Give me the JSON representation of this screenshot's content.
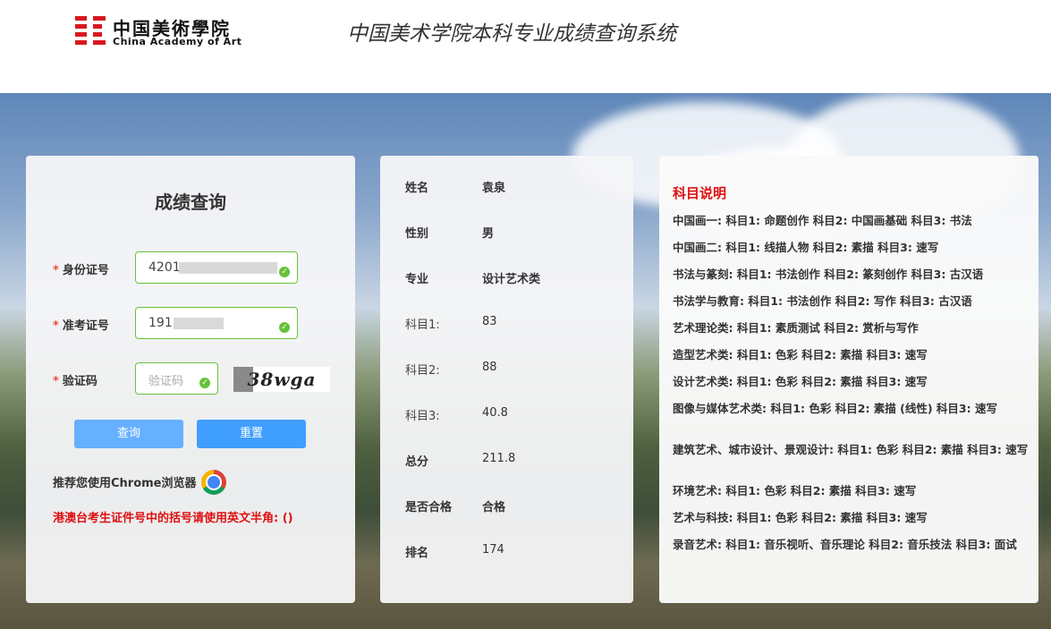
{
  "header": {
    "logo_cn": "中国美術學院",
    "logo_en": "China Academy of Art",
    "system_title": "中国美术学院本科专业成绩查询系统"
  },
  "query_form": {
    "title": "成绩查询",
    "required_mark": "*",
    "id_label": "身份证号",
    "id_value": "4201",
    "exam_label": "准考证号",
    "exam_value": "191",
    "captcha_label": "验证码",
    "captcha_placeholder": "验证码",
    "captcha_image_text": "38wga",
    "query_button": "查询",
    "reset_button": "重置",
    "browser_tip": "推荐您使用Chrome浏览器",
    "warning": "港澳台考生证件号中的括号请使用英文半角: ()"
  },
  "result": {
    "rows": [
      {
        "key": "姓名",
        "value": "袁泉"
      },
      {
        "key": "性别",
        "value": "男"
      },
      {
        "key": "专业",
        "value": "设计艺术类"
      },
      {
        "key": "科目1:",
        "value": "83"
      },
      {
        "key": "科目2:",
        "value": "88"
      },
      {
        "key": "科目3:",
        "value": "40.8"
      },
      {
        "key": "总分",
        "value": "211.8"
      },
      {
        "key": "是否合格",
        "value": "合格"
      },
      {
        "key": "排名",
        "value": "174"
      }
    ]
  },
  "subjects": {
    "title": "科目说明",
    "items": [
      "中国画一: 科目1: 命题创作 科目2: 中国画基础 科目3: 书法",
      "中国画二: 科目1: 线描人物 科目2: 素描 科目3: 速写",
      "书法与篆刻: 科目1: 书法创作 科目2: 篆刻创作 科目3: 古汉语",
      "书法学与教育: 科目1: 书法创作 科目2: 写作 科目3: 古汉语",
      "艺术理论类: 科目1: 素质测试 科目2: 赏析与写作",
      "造型艺术类: 科目1: 色彩 科目2: 素描 科目3: 速写",
      "设计艺术类: 科目1: 色彩 科目2: 素描 科目3: 速写",
      "图像与媒体艺术类: 科目1: 色彩 科目2: 素描 (线性) 科目3: 速写",
      "建筑艺术、城市设计、景观设计: 科目1: 色彩 科目2: 素描 科目3: 速写",
      "环境艺术: 科目1: 色彩 科目2: 素描 科目3: 速写",
      "艺术与科技: 科目1: 色彩 科目2: 素描 科目3: 速写",
      "录音艺术: 科目1: 音乐视听、音乐理论 科目2: 音乐技法 科目3: 面试"
    ]
  },
  "colors": {
    "brand_red": "#d7191f",
    "success_green": "#67c23a",
    "primary_blue": "#409eff",
    "warning_red": "#e01010"
  }
}
